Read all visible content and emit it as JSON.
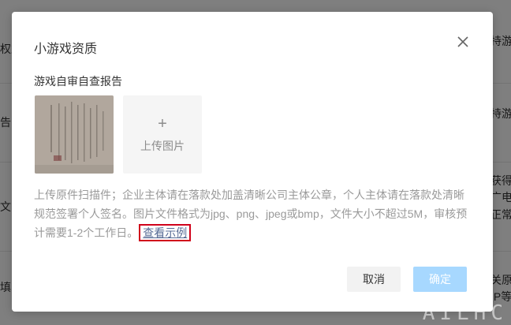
{
  "background": {
    "left_fragments": [
      "权益",
      "告",
      "文",
      "填"
    ],
    "right_fragments": [
      "持游",
      "持游",
      "获得",
      "广电",
      "正常",
      "关原",
      "IP等"
    ]
  },
  "dialog": {
    "title": "小游戏资质",
    "section_label": "游戏自审自查报告",
    "upload": {
      "plus": "+",
      "label": "上传图片"
    },
    "description": "上传原件扫描件；企业主体请在落款处加盖清晰公司主体公章，个人主体请在落款处清晰规范签署个人签名。图片文件格式为jpg、png、jpeg或bmp，文件大小不超过5M，审核预计需要1-2个工作日。",
    "example_link": "查看示例",
    "cancel_label": "取消",
    "confirm_label": "确定"
  },
  "watermark": "AILHC"
}
